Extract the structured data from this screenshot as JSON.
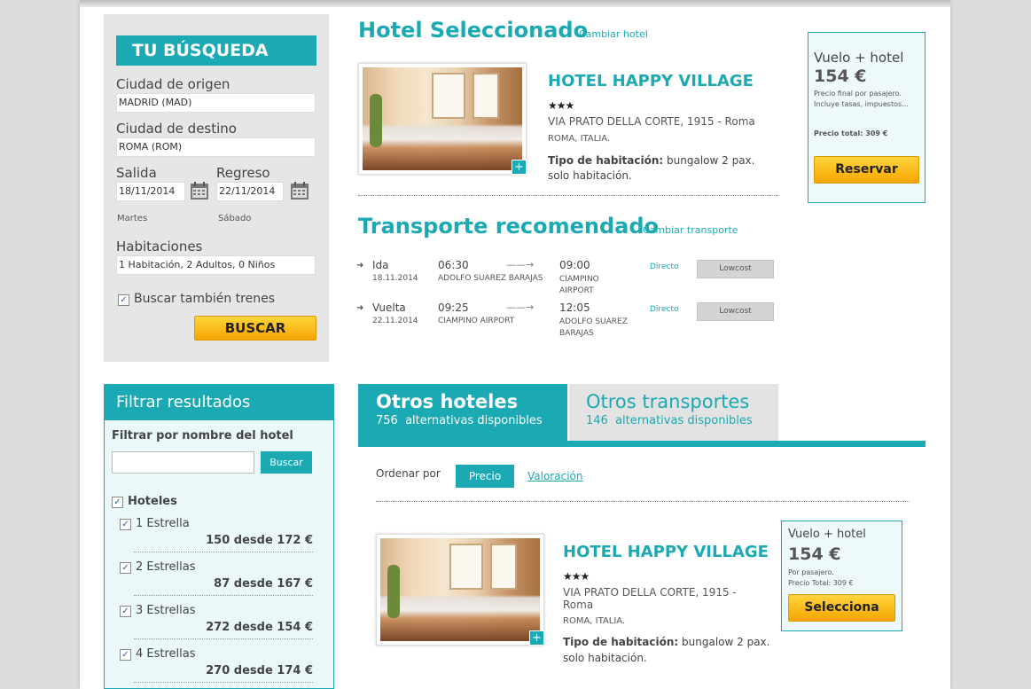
{
  "search": {
    "title": "TU BÚSQUEDA",
    "origin_label": "Ciudad de origen",
    "origin_value": "MADRID (MAD)",
    "destination_label": "Ciudad de destino",
    "destination_value": "ROMA (ROM)",
    "departure_label": "Salida",
    "departure_value": "18/11/2014",
    "departure_day": "Martes",
    "return_label": "Regreso",
    "return_value": "22/11/2014",
    "return_day": "Sábado",
    "rooms_label": "Habitaciones",
    "rooms_value": "1 Habitación, 2 Adultos, 0 Niños",
    "trains_label": "Buscar también trenes",
    "search_button": "BUSCAR"
  },
  "filter": {
    "title": "Filtrar resultados",
    "name_label": "Filtrar por nombre del hotel",
    "name_placeholder": "",
    "search_button": "Buscar",
    "hotels_label": "Hoteles",
    "stars": [
      {
        "label": "1 Estrella",
        "count": "150 desde 172 €"
      },
      {
        "label": "2 Estrellas",
        "count": "87 desde 167 €"
      },
      {
        "label": "3 Estrellas",
        "count": "272 desde 154 €"
      },
      {
        "label": "4 Estrellas",
        "count": "270 desde 174 €"
      }
    ]
  },
  "selected_hotel": {
    "heading": "Hotel Seleccionado",
    "change_link": "Cambiar hotel",
    "name": "HOTEL HAPPY VILLAGE",
    "stars": "★★★",
    "address": "VIA PRATO DELLA CORTE, 1915 - Roma",
    "city": "ROMA, ITALIA.",
    "room_type_label": "Tipo de habitación:",
    "room_type_value": " bungalow 2 pax. solo habitación."
  },
  "price_box": {
    "title": "Vuelo + hotel",
    "price": "154 €",
    "note1": "Precio final por pasajero.",
    "note2": "Incluye tasas, impuestos...",
    "total": "Precio total: 309 €",
    "button": "Reservar"
  },
  "transport": {
    "heading": "Transporte recomendado",
    "change_link": "Cambiar transporte",
    "legs": [
      {
        "direction": "Ida",
        "date": "18.11.2014",
        "dep_time": "06:30",
        "dep_airport": "ADOLFO SUAREZ BARAJAS",
        "arr_time": "09:00",
        "arr_airport": "CIAMPINO AIRPORT",
        "type": "Directo",
        "fare": "Lowcost"
      },
      {
        "direction": "Vuelta",
        "date": "22.11.2014",
        "dep_time": "09:25",
        "dep_airport": "CIAMPINO AIRPORT",
        "arr_time": "12:05",
        "arr_airport": "ADOLFO SUAREZ BARAJAS",
        "type": "Directo",
        "fare": "Lowcost"
      }
    ]
  },
  "tabs": {
    "hotels_title": "Otros hoteles",
    "hotels_count": "756",
    "hotels_sub": "alternativas disponibles",
    "transports_title": "Otros transportes",
    "transports_count": "146",
    "transports_sub": "alternativas disponibles"
  },
  "sort": {
    "label": "Ordenar por",
    "price": "Precio",
    "rating": "Valoración"
  },
  "result": {
    "name": "HOTEL HAPPY VILLAGE",
    "stars": "★★★",
    "address_line1": "VIA PRATO DELLA CORTE, 1915 -",
    "address_line2": "Roma",
    "city": "ROMA, ITALIA.",
    "room_type_label": "Tipo de habitación:",
    "room_type_value": " bungalow 2 pax.",
    "room_type_line2": "solo habitación.",
    "price_title": "Vuelo + hotel",
    "price": "154 €",
    "per_person": "Por pasajero.",
    "total": "Precio Total: 309 €",
    "button": "Selecciona"
  }
}
